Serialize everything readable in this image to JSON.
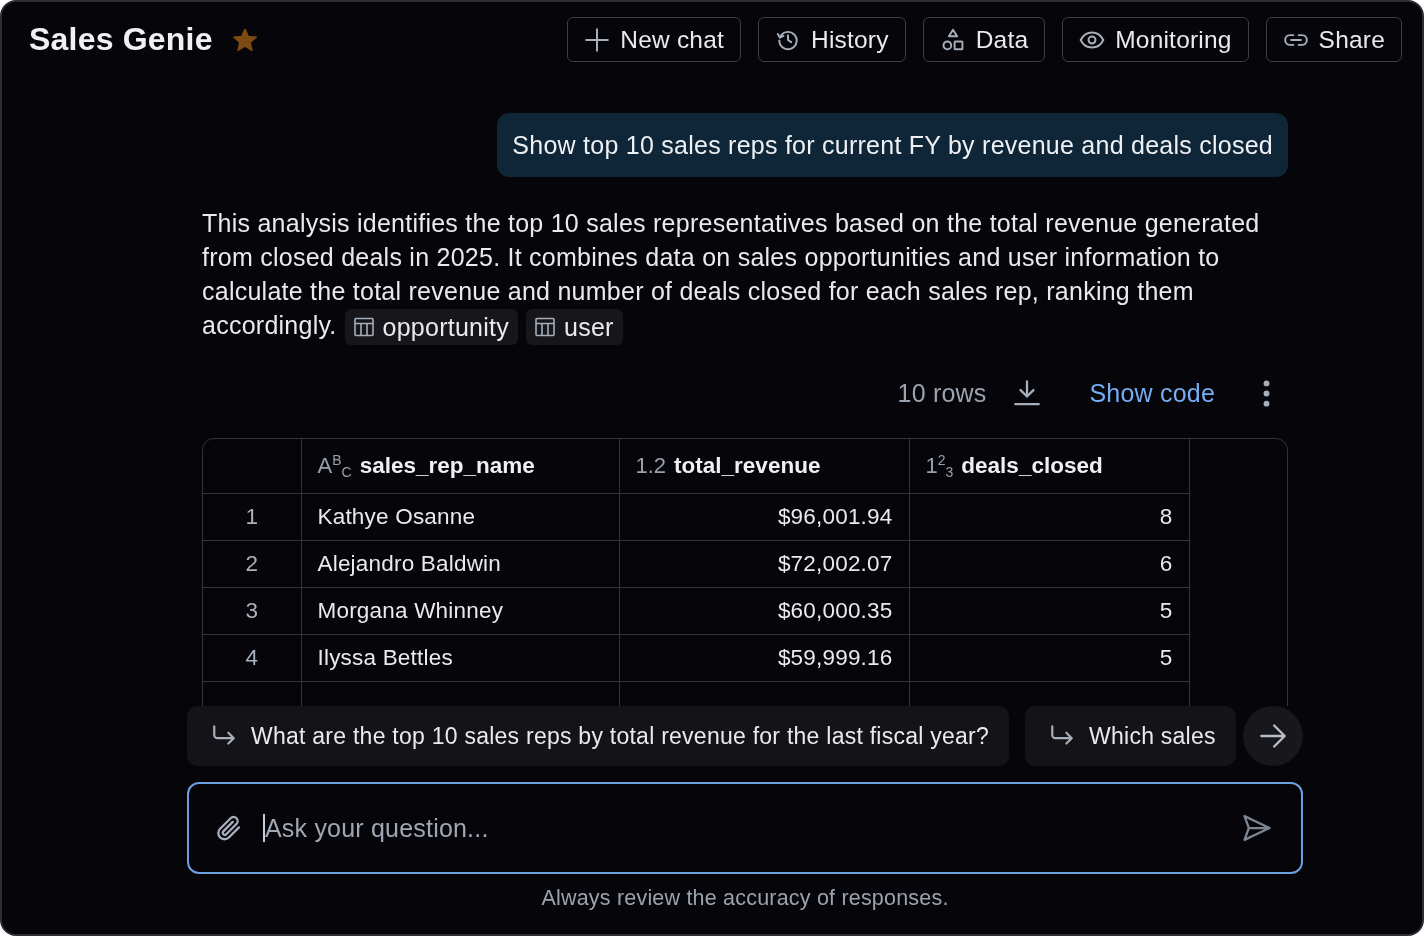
{
  "header": {
    "title": "Sales Genie",
    "starred": true,
    "buttons": [
      "New chat",
      "History",
      "Data",
      "Monitoring",
      "Share"
    ]
  },
  "conversation": {
    "user_message": "Show top 10 sales reps for current FY by revenue and deals closed",
    "answer": {
      "text": "This analysis identifies the top 10 sales representatives based on the total revenue generated from closed deals in 2025. It combines data on sales opportunities and user information to calculate the total revenue and number of deals closed for each sales rep, ranking them accordingly.",
      "tables": [
        "opportunity",
        "user"
      ]
    },
    "result": {
      "row_count": "10 rows",
      "show_code": "Show code",
      "columns": [
        {
          "type_icon": "A$^{B}$$_{C}$",
          "name": "sales_rep_name",
          "kind": "text"
        },
        {
          "type_icon": "1.2",
          "name": "total_revenue",
          "kind": "number"
        },
        {
          "type_icon": "1$^{2}$$_{3}$",
          "name": "deals_closed",
          "kind": "number"
        }
      ],
      "rows": [
        {
          "index": "1",
          "cells": [
            "Kathye Osanne",
            "$96,001.94",
            "8"
          ]
        },
        {
          "index": "2",
          "cells": [
            "Alejandro Baldwin",
            "$72,002.07",
            "6"
          ]
        },
        {
          "index": "3",
          "cells": [
            "Morgana Whinney",
            "$60,000.35",
            "5"
          ]
        },
        {
          "index": "4",
          "cells": [
            "Ilyssa Bettles",
            "$59,999.16",
            "5"
          ]
        }
      ]
    }
  },
  "suggestions": [
    "What are the top 10 sales reps by total revenue for the last fiscal year?",
    "Which sales"
  ],
  "composer": {
    "placeholder": "Ask your question..."
  },
  "disclaimer": "Always review the accuracy of responses."
}
